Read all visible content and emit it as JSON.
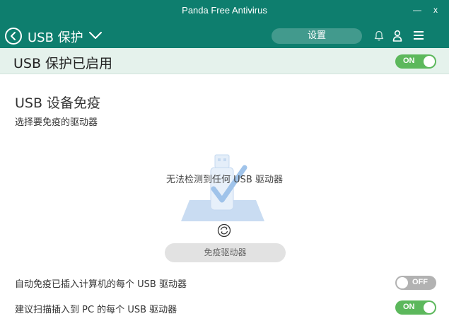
{
  "window": {
    "title": "Panda Free Antivirus",
    "minimize_glyph": "—",
    "close_glyph": "x"
  },
  "nav": {
    "title": "USB 保护",
    "settings_label": "设置",
    "icons": [
      "back-arrow-icon",
      "chevron-down-icon",
      "bell-icon",
      "user-icon",
      "hamburger-menu-icon"
    ]
  },
  "status": {
    "text": "USB 保护已启用",
    "toggle": {
      "label": "ON",
      "state": "on"
    }
  },
  "section": {
    "title": "USB 设备免疫",
    "subtitle": "选择要免疫的驱动器",
    "empty_text": "无法检测到任何 USB 驱动器",
    "vaccinate_label": "免疫驱动器"
  },
  "options": [
    {
      "label": "自动免疫已插入计算机的每个 USB 驱动器",
      "toggle_label": "OFF",
      "state": "off"
    },
    {
      "label": "建议扫描插入到 PC 的每个 USB 驱动器",
      "toggle_label": "ON",
      "state": "on"
    }
  ],
  "colors": {
    "header": "#0e7e6e",
    "status_bg": "#e5f2ec",
    "toggle_on": "#5cb85c",
    "toggle_off": "#b2b2b2",
    "illustration": "#9fc3ea"
  }
}
